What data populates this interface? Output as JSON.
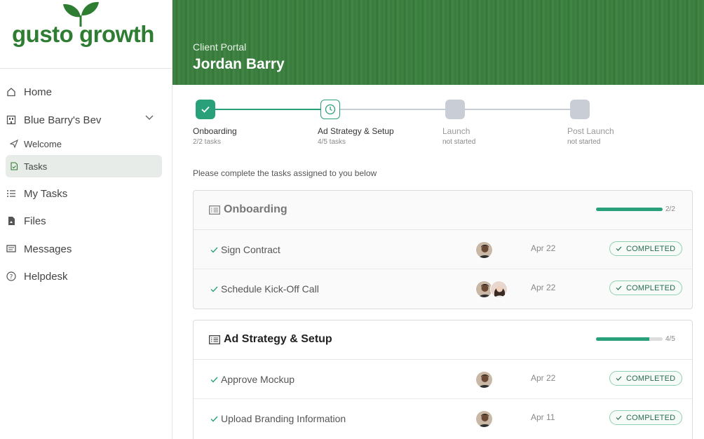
{
  "brand": {
    "name": "gusto growth",
    "color": "#2e7d32"
  },
  "sidebar": {
    "items": [
      {
        "label": "Home",
        "icon": "home-icon"
      },
      {
        "label": "Blue Barry's Bev",
        "icon": "building-icon"
      },
      {
        "label": "Welcome",
        "icon": "send-icon"
      },
      {
        "label": "Tasks",
        "icon": "document-icon"
      },
      {
        "label": "My Tasks",
        "icon": "list-icon"
      },
      {
        "label": "Files",
        "icon": "file-icon"
      },
      {
        "label": "Messages",
        "icon": "message-icon"
      },
      {
        "label": "Helpdesk",
        "icon": "help-icon"
      }
    ]
  },
  "header": {
    "subtitle": "Client Portal",
    "title": "Jordan Barry"
  },
  "stepper": {
    "steps": [
      {
        "label": "Onboarding",
        "meta": "2/2 tasks",
        "status": "complete"
      },
      {
        "label": "Ad Strategy & Setup",
        "meta": "4/5 tasks",
        "status": "in-progress"
      },
      {
        "label": "Launch",
        "meta": "not started",
        "status": "not-started"
      },
      {
        "label": "Post Launch",
        "meta": "not started",
        "status": "not-started"
      }
    ]
  },
  "instructions": "Please complete the tasks assigned to you below",
  "sections": [
    {
      "title": "Onboarding",
      "progress_text": "2/2",
      "progress": 1.0,
      "tasks": [
        {
          "name": "Sign Contract",
          "date": "Apr 22",
          "status": "COMPLETED"
        },
        {
          "name": "Schedule Kick-Off Call",
          "date": "Apr 22",
          "status": "COMPLETED"
        }
      ]
    },
    {
      "title": "Ad Strategy & Setup",
      "progress_text": "4/5",
      "progress": 0.8,
      "tasks": [
        {
          "name": "Approve Mockup",
          "date": "Apr 22",
          "status": "COMPLETED"
        },
        {
          "name": "Upload Branding Information",
          "date": "Apr 11",
          "status": "COMPLETED"
        }
      ]
    }
  ],
  "colors": {
    "accent": "#2aa07a",
    "header": "#3a7d3e"
  }
}
